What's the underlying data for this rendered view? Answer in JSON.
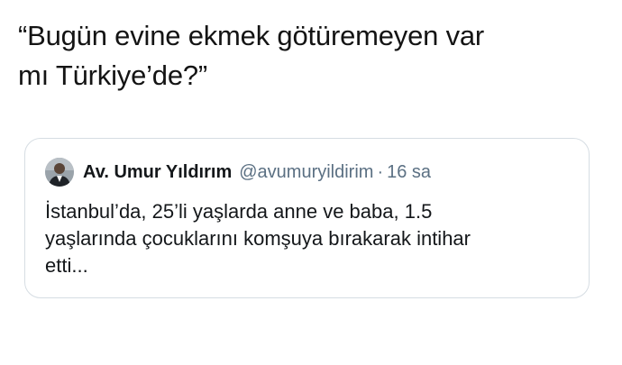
{
  "tweet": {
    "text": "“Bugün evine ekmek götüremeyen var\nmı Türkiye’de?”"
  },
  "quoted_tweet": {
    "author_name": "Av. Umur Yıldırım",
    "author_handle": "@avumuryildirim",
    "separator": "·",
    "timestamp": "16 sa",
    "text": "İstanbul’da, 25’li yaşlarda anne ve baba, 1.5\nyaşlarında çocuklarını komşuya bırakarak intihar\netti..."
  },
  "colors": {
    "text": "#141414",
    "secondary_text": "#5b7083",
    "card_border": "#d6dde3",
    "background": "#ffffff"
  }
}
